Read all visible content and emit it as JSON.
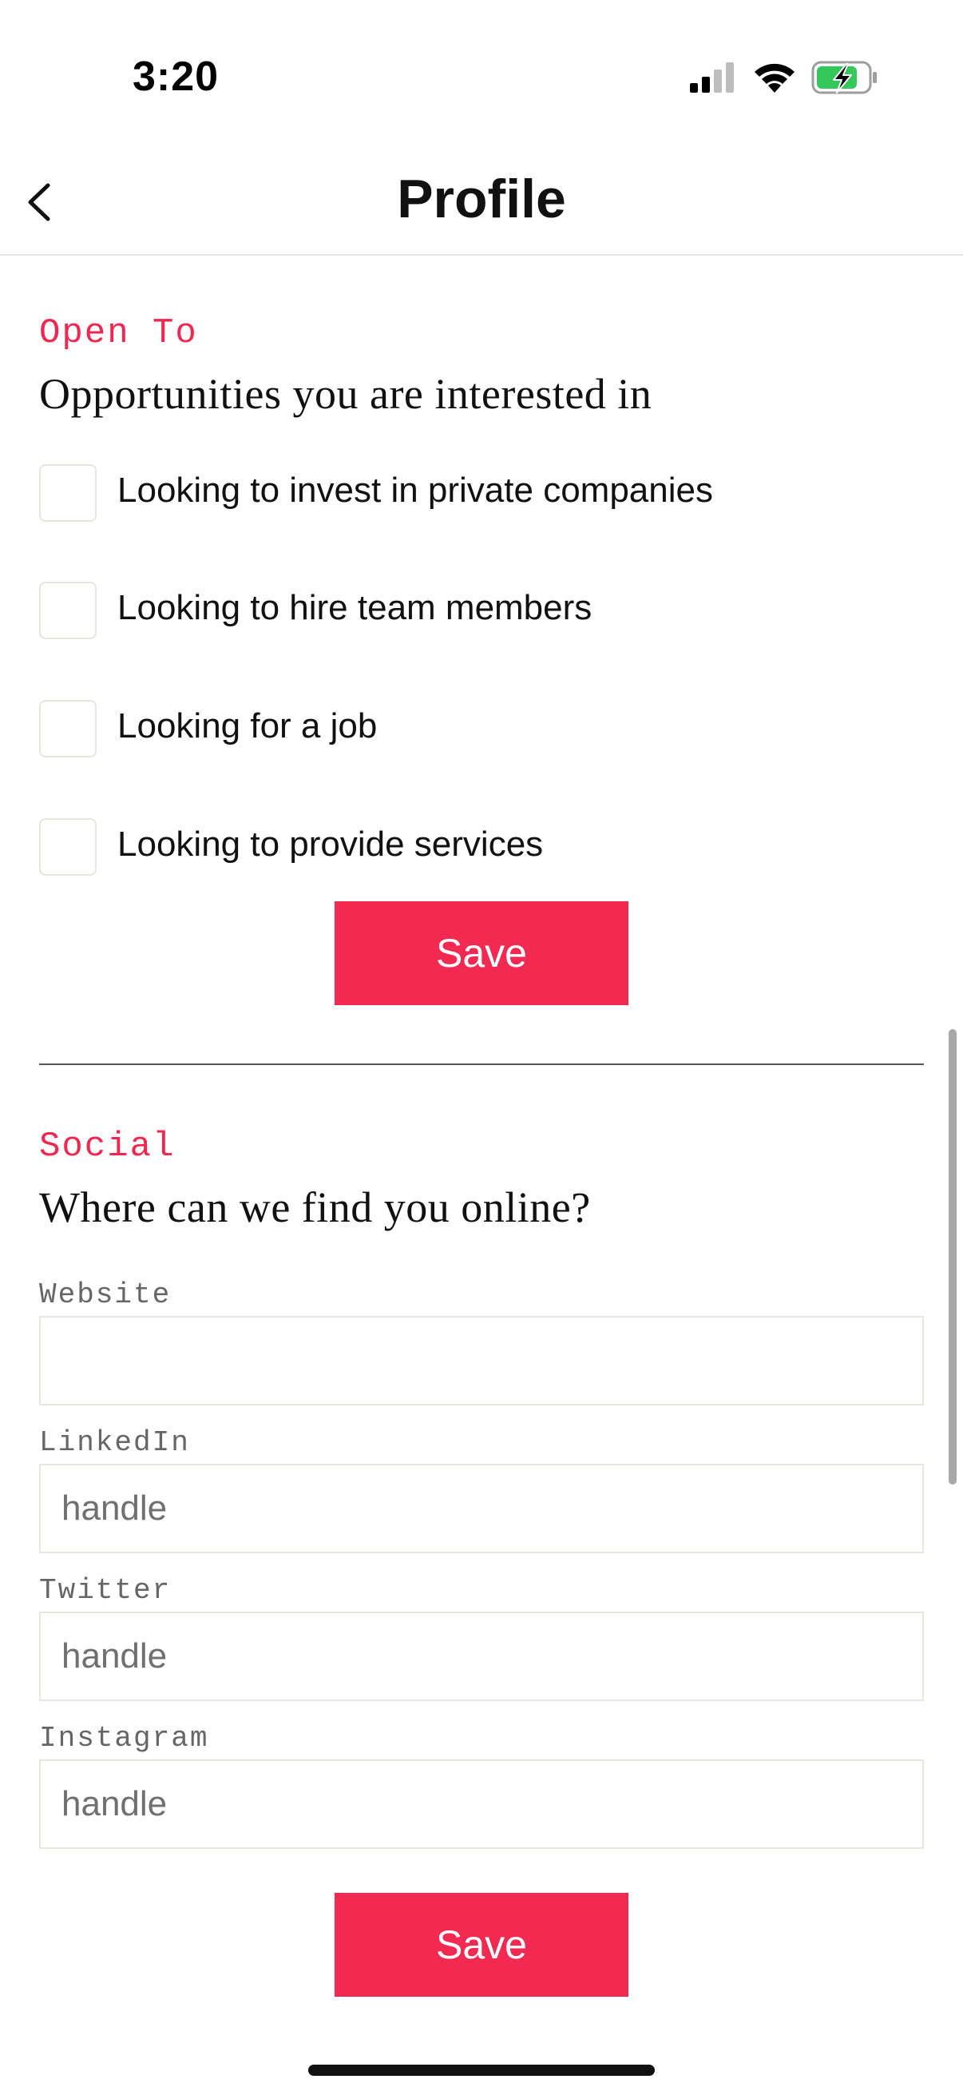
{
  "status_bar": {
    "time": "3:20",
    "icons": [
      "signal-icon",
      "wifi-icon",
      "battery-charging-icon"
    ]
  },
  "header": {
    "title": "Profile",
    "back_icon": "chevron-left-icon"
  },
  "open_to": {
    "label": "Open To",
    "heading": "Opportunities you are interested in",
    "options": [
      {
        "label": "Looking to invest in private companies",
        "checked": false
      },
      {
        "label": "Looking to hire team members",
        "checked": false
      },
      {
        "label": "Looking for a job",
        "checked": false
      },
      {
        "label": "Looking to provide services",
        "checked": false
      }
    ],
    "save_label": "Save"
  },
  "social": {
    "label": "Social",
    "heading": "Where can we find you online?",
    "fields": [
      {
        "label": "Website",
        "value": "",
        "placeholder": ""
      },
      {
        "label": "LinkedIn",
        "value": "",
        "placeholder": "handle"
      },
      {
        "label": "Twitter",
        "value": "",
        "placeholder": "handle"
      },
      {
        "label": "Instagram",
        "value": "",
        "placeholder": "handle"
      }
    ],
    "save_label": "Save"
  },
  "colors": {
    "accent": "#f22a51",
    "section_label": "#f0284f",
    "input_border": "#e9e6df"
  }
}
